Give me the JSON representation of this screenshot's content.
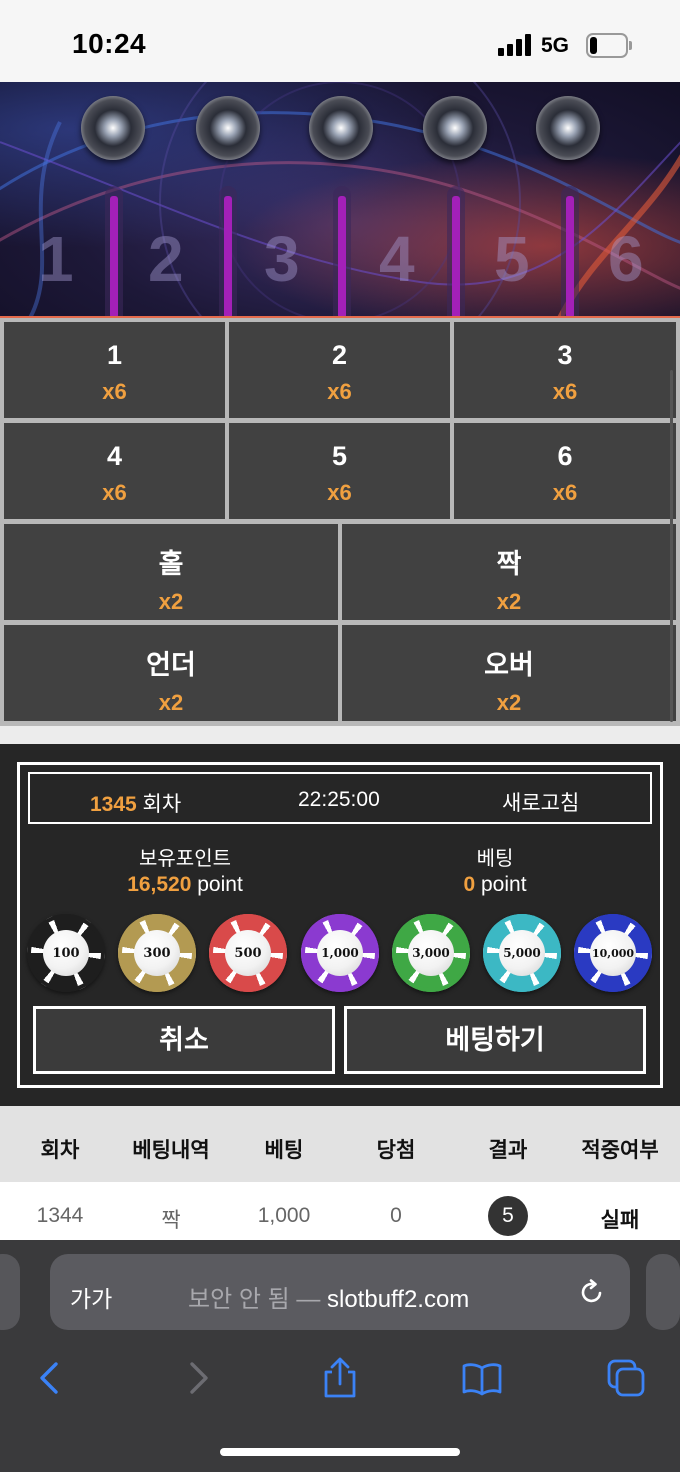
{
  "status_bar": {
    "time": "10:24",
    "network": "5G",
    "battery_level": 0.2
  },
  "banner": {
    "ghost_numbers": [
      "1",
      "2",
      "3",
      "4",
      "5",
      "6"
    ],
    "accent_color": "#a320b8"
  },
  "bet_options": {
    "numbers": [
      {
        "label": "1",
        "odds": "x6"
      },
      {
        "label": "2",
        "odds": "x6"
      },
      {
        "label": "3",
        "odds": "x6"
      },
      {
        "label": "4",
        "odds": "x6"
      },
      {
        "label": "5",
        "odds": "x6"
      },
      {
        "label": "6",
        "odds": "x6"
      }
    ],
    "odd": {
      "label": "홀",
      "odds": "x2"
    },
    "even": {
      "label": "짝",
      "odds": "x2"
    },
    "under": {
      "label": "언더",
      "odds": "x2"
    },
    "over": {
      "label": "오버",
      "odds": "x2"
    }
  },
  "panel": {
    "round_number": "1345",
    "round_suffix": " 회차",
    "clock": "22:25:00",
    "refresh_label": "새로고침",
    "points_title": "보유포인트",
    "points_value": "16,520",
    "points_unit": " point",
    "bet_title": "베팅",
    "bet_value": "0",
    "bet_unit": " point",
    "chips": [
      {
        "value": "100",
        "color": "#1e1e1e"
      },
      {
        "value": "300",
        "color": "#b39a52"
      },
      {
        "value": "500",
        "color": "#d94a4a"
      },
      {
        "value": "1,000",
        "color": "#8b3ad0"
      },
      {
        "value": "3,000",
        "color": "#3fa845"
      },
      {
        "value": "5,000",
        "color": "#3cb8c4"
      },
      {
        "value": "10,000",
        "color": "#2a3ac2"
      }
    ],
    "cancel_label": "취소",
    "bet_label": "베팅하기",
    "accent_color": "#f0a040"
  },
  "history": {
    "headers": [
      "회차",
      "베팅내역",
      "베팅",
      "당첨",
      "결과",
      "적중여부"
    ],
    "rows": [
      {
        "round": "1344",
        "bet_type": "짝",
        "amount": "1,000",
        "won": "0",
        "result": "5",
        "status": "실패"
      }
    ]
  },
  "browser": {
    "text_size_label": "가가",
    "insecure_label": "보안 안 됨 — ",
    "domain": "slotbuff2.com"
  }
}
